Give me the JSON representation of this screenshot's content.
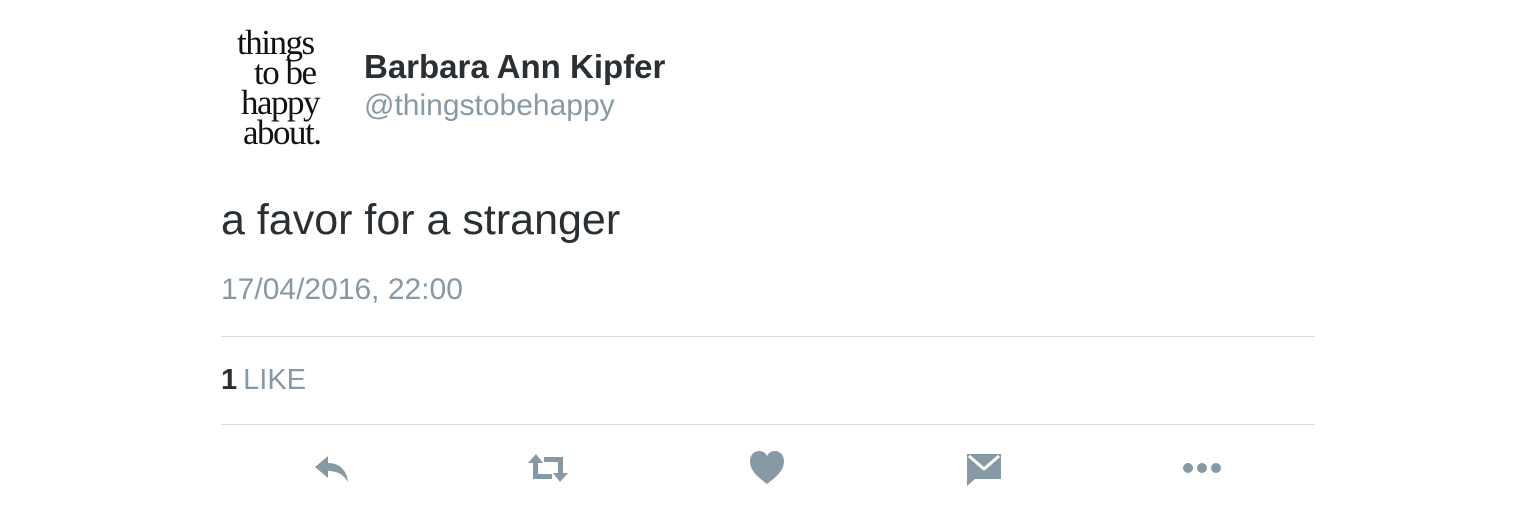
{
  "author": {
    "avatar_text": [
      "things",
      "to be",
      "happy",
      "about."
    ],
    "display_name": "Barbara Ann Kipfer",
    "handle": "@thingstobehappy"
  },
  "tweet": {
    "text": "a favor for a stranger",
    "timestamp": "17/04/2016, 22:00"
  },
  "stats": {
    "like_count": "1",
    "like_label": "LIKE"
  },
  "actions": [
    {
      "name": "reply",
      "icon": "reply-icon"
    },
    {
      "name": "retweet",
      "icon": "retweet-icon"
    },
    {
      "name": "like",
      "icon": "heart-icon"
    },
    {
      "name": "direct-message",
      "icon": "envelope-icon"
    },
    {
      "name": "more",
      "icon": "more-dots-icon"
    }
  ],
  "colors": {
    "text_primary": "#292f33",
    "text_secondary": "#8899a6",
    "icon": "#8899a6",
    "divider": "#d8dfe4",
    "background": "#ffffff"
  }
}
